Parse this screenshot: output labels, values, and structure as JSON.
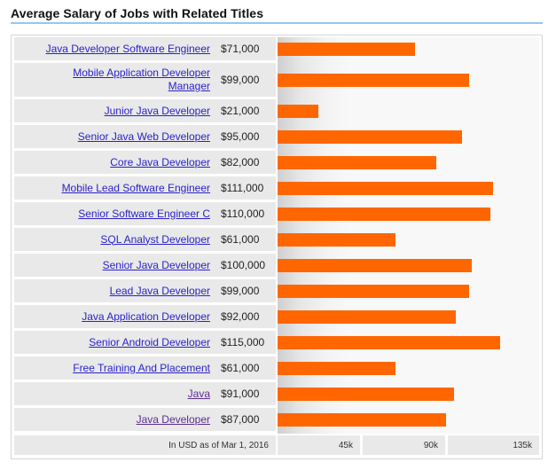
{
  "title": "Average Salary of Jobs with Related Titles",
  "colors": {
    "bar": "#ff6600",
    "link": "#2a22c8",
    "visited_link": "#5a2e8e",
    "title_rule": "#99c5ee"
  },
  "footer_note": "In USD as of Mar 1, 2016",
  "chart_data": {
    "type": "bar",
    "orientation": "horizontal",
    "title": "Average Salary of Jobs with Related Titles",
    "xlabel": "In USD as of Mar 1, 2016",
    "ylabel": "",
    "xlim": [
      0,
      135000
    ],
    "xticks": [
      45000,
      90000,
      135000
    ],
    "xtick_labels": [
      "45k",
      "90k",
      "135k"
    ],
    "grid": false,
    "categories": [
      "Java Developer Software Engineer",
      "Mobile Application Developer Manager",
      "Junior Java Developer",
      "Senior Java Web Developer",
      "Core Java Developer",
      "Mobile Lead Software Engineer",
      "Senior Software Engineer C",
      "SQL Analyst Developer",
      "Senior Java Developer",
      "Lead Java Developer",
      "Java Application Developer",
      "Senior Android Developer",
      "Free Training And Placement",
      "Java",
      "Java Developer"
    ],
    "values": [
      71000,
      99000,
      21000,
      95000,
      82000,
      111000,
      110000,
      61000,
      100000,
      99000,
      92000,
      115000,
      61000,
      91000,
      87000
    ],
    "value_labels": [
      "$71,000",
      "$99,000",
      "$21,000",
      "$95,000",
      "$82,000",
      "$111,000",
      "$110,000",
      "$61,000",
      "$100,000",
      "$99,000",
      "$92,000",
      "$115,000",
      "$61,000",
      "$91,000",
      "$87,000"
    ],
    "visited": [
      false,
      false,
      false,
      false,
      false,
      false,
      false,
      false,
      false,
      false,
      false,
      false,
      false,
      true,
      true
    ]
  }
}
